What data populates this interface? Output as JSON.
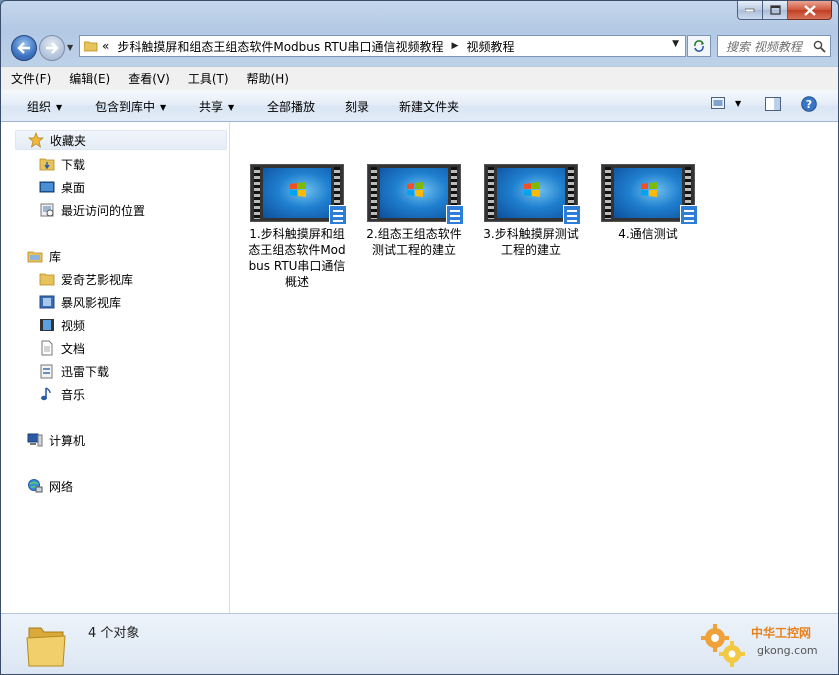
{
  "window": {
    "caption_buttons": {
      "minimize": "minimize",
      "maximize": "maximize",
      "close": "close"
    }
  },
  "address_bar": {
    "overflow_marker": "«",
    "breadcrumbs": [
      "步科触摸屏和组态王组态软件Modbus RTU串口通信视频教程",
      "视频教程"
    ],
    "search_placeholder": "搜索 视频教程"
  },
  "menu": {
    "items": [
      "文件(F)",
      "编辑(E)",
      "查看(V)",
      "工具(T)",
      "帮助(H)"
    ]
  },
  "toolbar": {
    "organize": "组织",
    "include_in_library": "包含到库中",
    "share": "共享",
    "play_all": "全部播放",
    "burn": "刻录",
    "new_folder": "新建文件夹"
  },
  "sidebar": {
    "favorites": {
      "label": "收藏夹",
      "items": [
        "下载",
        "桌面",
        "最近访问的位置"
      ]
    },
    "libraries": {
      "label": "库",
      "items": [
        "爱奇艺影视库",
        "暴风影视库",
        "视频",
        "文档",
        "迅雷下载",
        "音乐"
      ]
    },
    "computer": "计算机",
    "network": "网络"
  },
  "files": [
    {
      "name": "1.步科触摸屏和组态王组态软件Modbus RTU串口通信概述"
    },
    {
      "name": "2.组态王组态软件测试工程的建立"
    },
    {
      "name": "3.步科触摸屏测试工程的建立"
    },
    {
      "name": "4.通信测试"
    }
  ],
  "status": {
    "count_text": "4 个对象"
  },
  "watermark": {
    "line1": "中华工控网",
    "line2": "gkong.com"
  },
  "colors": {
    "accent": "#3f74c2",
    "close_red": "#c03e22",
    "watermark_orange": "#e9811a"
  }
}
